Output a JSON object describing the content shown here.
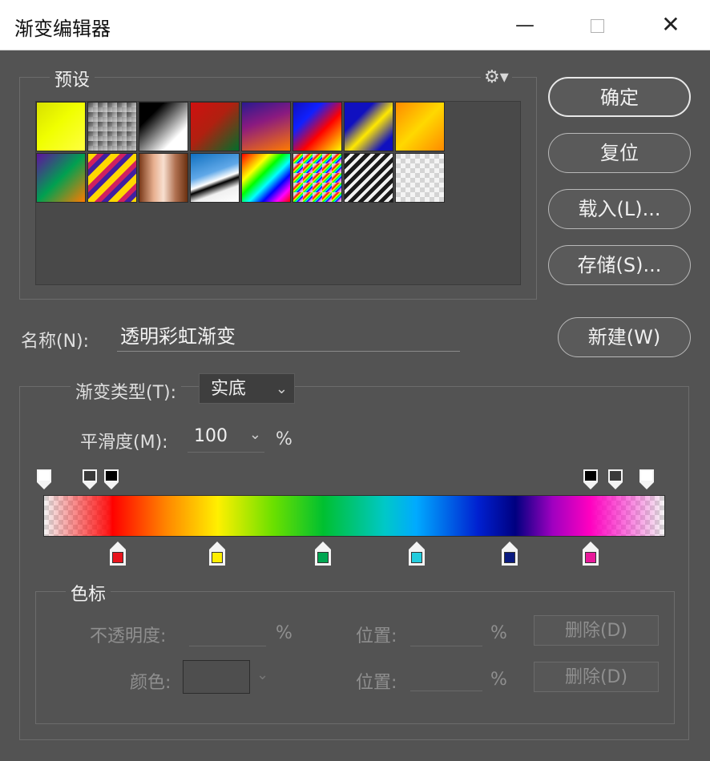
{
  "window": {
    "title": "渐变编辑器",
    "min_glyph": "—",
    "close_glyph": "✕"
  },
  "presets": {
    "legend": "预设",
    "gear_glyph": "⚙▾",
    "swatches": [
      {
        "name": "yellow-green"
      },
      {
        "name": "checker-transparent"
      },
      {
        "name": "black-white"
      },
      {
        "name": "red-green"
      },
      {
        "name": "violet-orange"
      },
      {
        "name": "blue-red-yellow"
      },
      {
        "name": "blue-yellow-blue"
      },
      {
        "name": "orange-yellow-orange"
      },
      {
        "name": "violet-green-orange"
      },
      {
        "name": "yellow-violet-stripes"
      },
      {
        "name": "copper"
      },
      {
        "name": "chrome"
      },
      {
        "name": "spectrum"
      },
      {
        "name": "transparent-rainbow"
      },
      {
        "name": "transparent-stripes"
      },
      {
        "name": "checker-transparent-2"
      }
    ]
  },
  "buttons": {
    "ok": "确定",
    "reset": "复位",
    "load": "载入(L)...",
    "save": "存储(S)...",
    "new": "新建(W)"
  },
  "name": {
    "label": "名称(N):",
    "value": "透明彩虹渐变"
  },
  "gradient": {
    "type_label": "渐变类型(T):",
    "type_value": "实底",
    "smooth_label": "平滑度(M):",
    "smooth_value": "100",
    "smooth_unit": "%",
    "opacity_stops": [
      0,
      0.075,
      0.11,
      0.88,
      0.92,
      0.97
    ],
    "color_stops": [
      {
        "pos": 0.12,
        "color": "#e8141c"
      },
      {
        "pos": 0.28,
        "color": "#ffee00"
      },
      {
        "pos": 0.45,
        "color": "#00a651"
      },
      {
        "pos": 0.6,
        "color": "#22ccdd"
      },
      {
        "pos": 0.75,
        "color": "#0a1a80"
      },
      {
        "pos": 0.88,
        "color": "#e8189a"
      }
    ]
  },
  "color_stops": {
    "legend": "色标",
    "opacity_label": "不透明度:",
    "percent": "%",
    "location_label": "位置:",
    "delete_label": "删除(D)",
    "color_label": "颜色:",
    "chevron": "⌄"
  }
}
